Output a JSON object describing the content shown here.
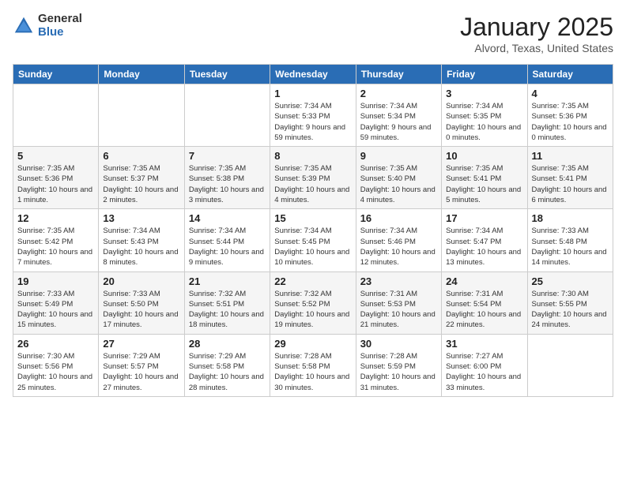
{
  "header": {
    "logo_general": "General",
    "logo_blue": "Blue",
    "title": "January 2025",
    "subtitle": "Alvord, Texas, United States"
  },
  "calendar": {
    "days_of_week": [
      "Sunday",
      "Monday",
      "Tuesday",
      "Wednesday",
      "Thursday",
      "Friday",
      "Saturday"
    ],
    "weeks": [
      [
        {
          "day": "",
          "info": ""
        },
        {
          "day": "",
          "info": ""
        },
        {
          "day": "",
          "info": ""
        },
        {
          "day": "1",
          "info": "Sunrise: 7:34 AM\nSunset: 5:33 PM\nDaylight: 9 hours and 59 minutes."
        },
        {
          "day": "2",
          "info": "Sunrise: 7:34 AM\nSunset: 5:34 PM\nDaylight: 9 hours and 59 minutes."
        },
        {
          "day": "3",
          "info": "Sunrise: 7:34 AM\nSunset: 5:35 PM\nDaylight: 10 hours and 0 minutes."
        },
        {
          "day": "4",
          "info": "Sunrise: 7:35 AM\nSunset: 5:36 PM\nDaylight: 10 hours and 0 minutes."
        }
      ],
      [
        {
          "day": "5",
          "info": "Sunrise: 7:35 AM\nSunset: 5:36 PM\nDaylight: 10 hours and 1 minute."
        },
        {
          "day": "6",
          "info": "Sunrise: 7:35 AM\nSunset: 5:37 PM\nDaylight: 10 hours and 2 minutes."
        },
        {
          "day": "7",
          "info": "Sunrise: 7:35 AM\nSunset: 5:38 PM\nDaylight: 10 hours and 3 minutes."
        },
        {
          "day": "8",
          "info": "Sunrise: 7:35 AM\nSunset: 5:39 PM\nDaylight: 10 hours and 4 minutes."
        },
        {
          "day": "9",
          "info": "Sunrise: 7:35 AM\nSunset: 5:40 PM\nDaylight: 10 hours and 4 minutes."
        },
        {
          "day": "10",
          "info": "Sunrise: 7:35 AM\nSunset: 5:41 PM\nDaylight: 10 hours and 5 minutes."
        },
        {
          "day": "11",
          "info": "Sunrise: 7:35 AM\nSunset: 5:41 PM\nDaylight: 10 hours and 6 minutes."
        }
      ],
      [
        {
          "day": "12",
          "info": "Sunrise: 7:35 AM\nSunset: 5:42 PM\nDaylight: 10 hours and 7 minutes."
        },
        {
          "day": "13",
          "info": "Sunrise: 7:34 AM\nSunset: 5:43 PM\nDaylight: 10 hours and 8 minutes."
        },
        {
          "day": "14",
          "info": "Sunrise: 7:34 AM\nSunset: 5:44 PM\nDaylight: 10 hours and 9 minutes."
        },
        {
          "day": "15",
          "info": "Sunrise: 7:34 AM\nSunset: 5:45 PM\nDaylight: 10 hours and 10 minutes."
        },
        {
          "day": "16",
          "info": "Sunrise: 7:34 AM\nSunset: 5:46 PM\nDaylight: 10 hours and 12 minutes."
        },
        {
          "day": "17",
          "info": "Sunrise: 7:34 AM\nSunset: 5:47 PM\nDaylight: 10 hours and 13 minutes."
        },
        {
          "day": "18",
          "info": "Sunrise: 7:33 AM\nSunset: 5:48 PM\nDaylight: 10 hours and 14 minutes."
        }
      ],
      [
        {
          "day": "19",
          "info": "Sunrise: 7:33 AM\nSunset: 5:49 PM\nDaylight: 10 hours and 15 minutes."
        },
        {
          "day": "20",
          "info": "Sunrise: 7:33 AM\nSunset: 5:50 PM\nDaylight: 10 hours and 17 minutes."
        },
        {
          "day": "21",
          "info": "Sunrise: 7:32 AM\nSunset: 5:51 PM\nDaylight: 10 hours and 18 minutes."
        },
        {
          "day": "22",
          "info": "Sunrise: 7:32 AM\nSunset: 5:52 PM\nDaylight: 10 hours and 19 minutes."
        },
        {
          "day": "23",
          "info": "Sunrise: 7:31 AM\nSunset: 5:53 PM\nDaylight: 10 hours and 21 minutes."
        },
        {
          "day": "24",
          "info": "Sunrise: 7:31 AM\nSunset: 5:54 PM\nDaylight: 10 hours and 22 minutes."
        },
        {
          "day": "25",
          "info": "Sunrise: 7:30 AM\nSunset: 5:55 PM\nDaylight: 10 hours and 24 minutes."
        }
      ],
      [
        {
          "day": "26",
          "info": "Sunrise: 7:30 AM\nSunset: 5:56 PM\nDaylight: 10 hours and 25 minutes."
        },
        {
          "day": "27",
          "info": "Sunrise: 7:29 AM\nSunset: 5:57 PM\nDaylight: 10 hours and 27 minutes."
        },
        {
          "day": "28",
          "info": "Sunrise: 7:29 AM\nSunset: 5:58 PM\nDaylight: 10 hours and 28 minutes."
        },
        {
          "day": "29",
          "info": "Sunrise: 7:28 AM\nSunset: 5:58 PM\nDaylight: 10 hours and 30 minutes."
        },
        {
          "day": "30",
          "info": "Sunrise: 7:28 AM\nSunset: 5:59 PM\nDaylight: 10 hours and 31 minutes."
        },
        {
          "day": "31",
          "info": "Sunrise: 7:27 AM\nSunset: 6:00 PM\nDaylight: 10 hours and 33 minutes."
        },
        {
          "day": "",
          "info": ""
        }
      ]
    ]
  }
}
